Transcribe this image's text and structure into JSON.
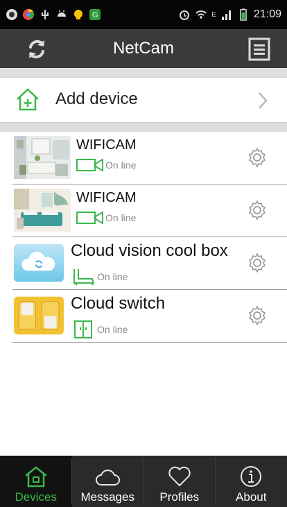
{
  "status_bar": {
    "time": "21:09",
    "network": "E"
  },
  "app_bar": {
    "title": "NetCam"
  },
  "add_device": {
    "label": "Add device"
  },
  "devices": [
    {
      "name": "WIFICAM",
      "status": "On line",
      "type_icon": "camera-icon",
      "thumb": "living-room-photo"
    },
    {
      "name": "WIFICAM",
      "status": "On line",
      "type_icon": "camera-icon",
      "thumb": "bedroom-photo"
    },
    {
      "name": "Cloud vision cool box",
      "status": "On line",
      "type_icon": "router-icon",
      "thumb": "cloud-icon"
    },
    {
      "name": "Cloud switch",
      "status": "On line",
      "type_icon": "switch-icon",
      "thumb": "switch-photo"
    }
  ],
  "bottom_nav": [
    {
      "label": "Devices",
      "icon": "home-icon",
      "active": true
    },
    {
      "label": "Messages",
      "icon": "cloud-icon",
      "active": false
    },
    {
      "label": "Profiles",
      "icon": "heart-icon",
      "active": false
    },
    {
      "label": "About",
      "icon": "info-icon",
      "active": false
    }
  ],
  "colors": {
    "accent": "#3bb84a",
    "appbar": "#3a3a3a",
    "nav": "#2a2a2a"
  }
}
